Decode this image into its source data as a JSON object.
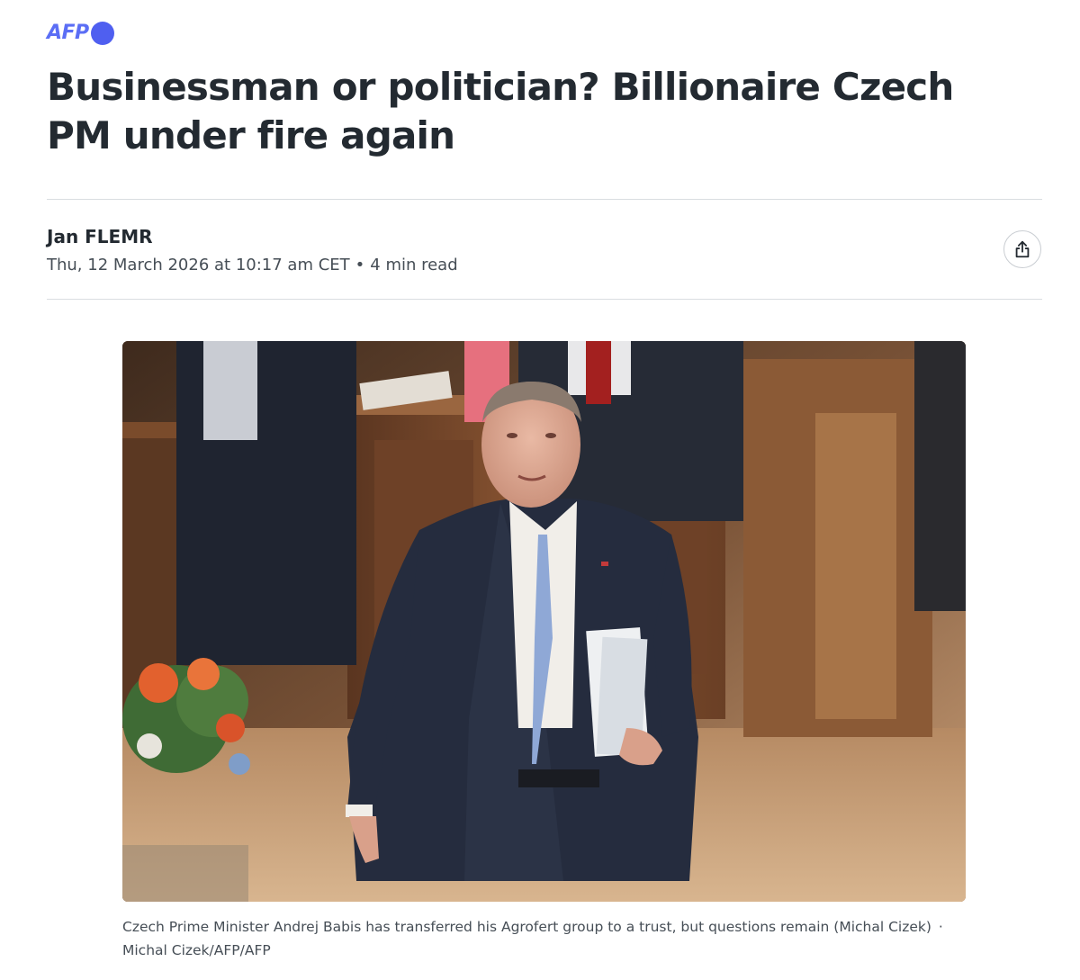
{
  "brand": {
    "logo_text": "AFP",
    "logo_color": "#5b6ef5"
  },
  "article": {
    "headline": "Businessman or politician? Billionaire Czech PM under fire again",
    "author": "Jan FLEMR",
    "date": "Thu, 12 March 2026 at 10:17 am CET",
    "separator": "•",
    "read_time": "4 min read"
  },
  "share": {
    "icon": "share-icon"
  },
  "image": {
    "caption": "Czech Prime Minister Andrej Babis has transferred his Agrofert group to a trust, but questions remain (Michal Cizek)",
    "caption_separator": "·",
    "credit": "Michal Cizek/AFP/AFP"
  },
  "colors": {
    "text": "#232a31",
    "meta_text": "#464e56",
    "rule": "#d9dde1"
  }
}
